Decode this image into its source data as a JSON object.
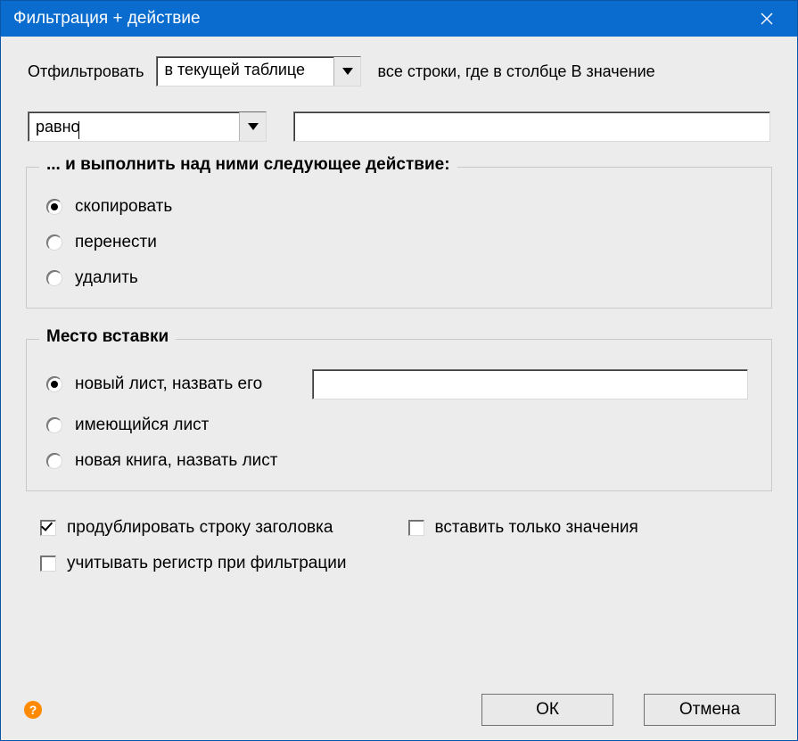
{
  "titlebar": {
    "title": "Фильтрация + действие"
  },
  "row1": {
    "filter_label": "Отфильтровать",
    "scope_value": "в текущей таблице",
    "trailing": "все строки, где в столбце B значение"
  },
  "row2": {
    "condition_value": "равно",
    "value_input": ""
  },
  "action_group": {
    "legend": "... и выполнить над ними следующее действие:",
    "options": [
      {
        "label": "скопировать",
        "selected": true
      },
      {
        "label": "перенести",
        "selected": false
      },
      {
        "label": "удалить",
        "selected": false
      }
    ]
  },
  "dest_group": {
    "legend": "Место вставки",
    "options": [
      {
        "label": "новый лист, назвать его",
        "selected": true,
        "has_input": true,
        "input_value": ""
      },
      {
        "label": "имеющийся лист",
        "selected": false,
        "has_input": false
      },
      {
        "label": "новая книга, назвать лист",
        "selected": false,
        "has_input": false
      }
    ]
  },
  "checks": {
    "dup_header": {
      "label": "продублировать строку заголовка",
      "checked": true
    },
    "values_only": {
      "label": "вставить только значения",
      "checked": false
    },
    "case_sensitive": {
      "label": "учитывать регистр при фильтрации",
      "checked": false
    }
  },
  "footer": {
    "help": "?",
    "ok": "ОК",
    "cancel": "Отмена"
  }
}
